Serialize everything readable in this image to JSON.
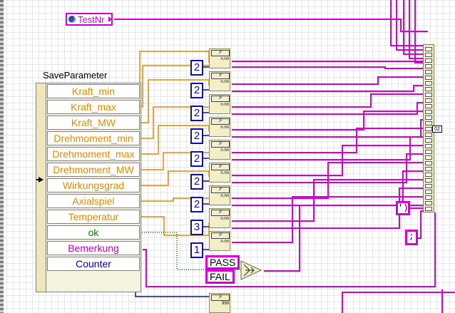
{
  "global": {
    "name": "TestNr",
    "icon": "globe-icon"
  },
  "cluster": {
    "label": "SaveParameter",
    "fields": [
      {
        "name": "Kraft_min",
        "color": "orange"
      },
      {
        "name": "Kraft_max",
        "color": "orange"
      },
      {
        "name": "Kraft_MW",
        "color": "orange"
      },
      {
        "name": "Drehmoment_min",
        "color": "orange"
      },
      {
        "name": "Drehmoment_max",
        "color": "orange"
      },
      {
        "name": "Drehmoment_MW",
        "color": "orange"
      },
      {
        "name": "Wirkungsgrad",
        "color": "orange"
      },
      {
        "name": "Axialspiel",
        "color": "orange"
      },
      {
        "name": "Temperatur",
        "color": "orange"
      },
      {
        "name": "ok",
        "color": "green"
      },
      {
        "name": "Bemerkung",
        "color": "pink"
      },
      {
        "name": "Counter",
        "color": "blue"
      }
    ]
  },
  "precision_constants": [
    "2",
    "2",
    "2",
    "2",
    "2",
    "2",
    "2",
    "3",
    "1"
  ],
  "format_node_text": "n.nn",
  "counter_format_text": "999",
  "select_constants": {
    "true": "PASS",
    "false": "FAIL"
  },
  "delimiter_constants": {
    "close_paren": "')",
    "semicolon": ";"
  },
  "bundle_tag": "02",
  "colors": {
    "string_wire": "#d400d4",
    "numeric_wire": "#e08a00",
    "integer_wire": "#1010a0",
    "bool_wire": "#008000"
  }
}
